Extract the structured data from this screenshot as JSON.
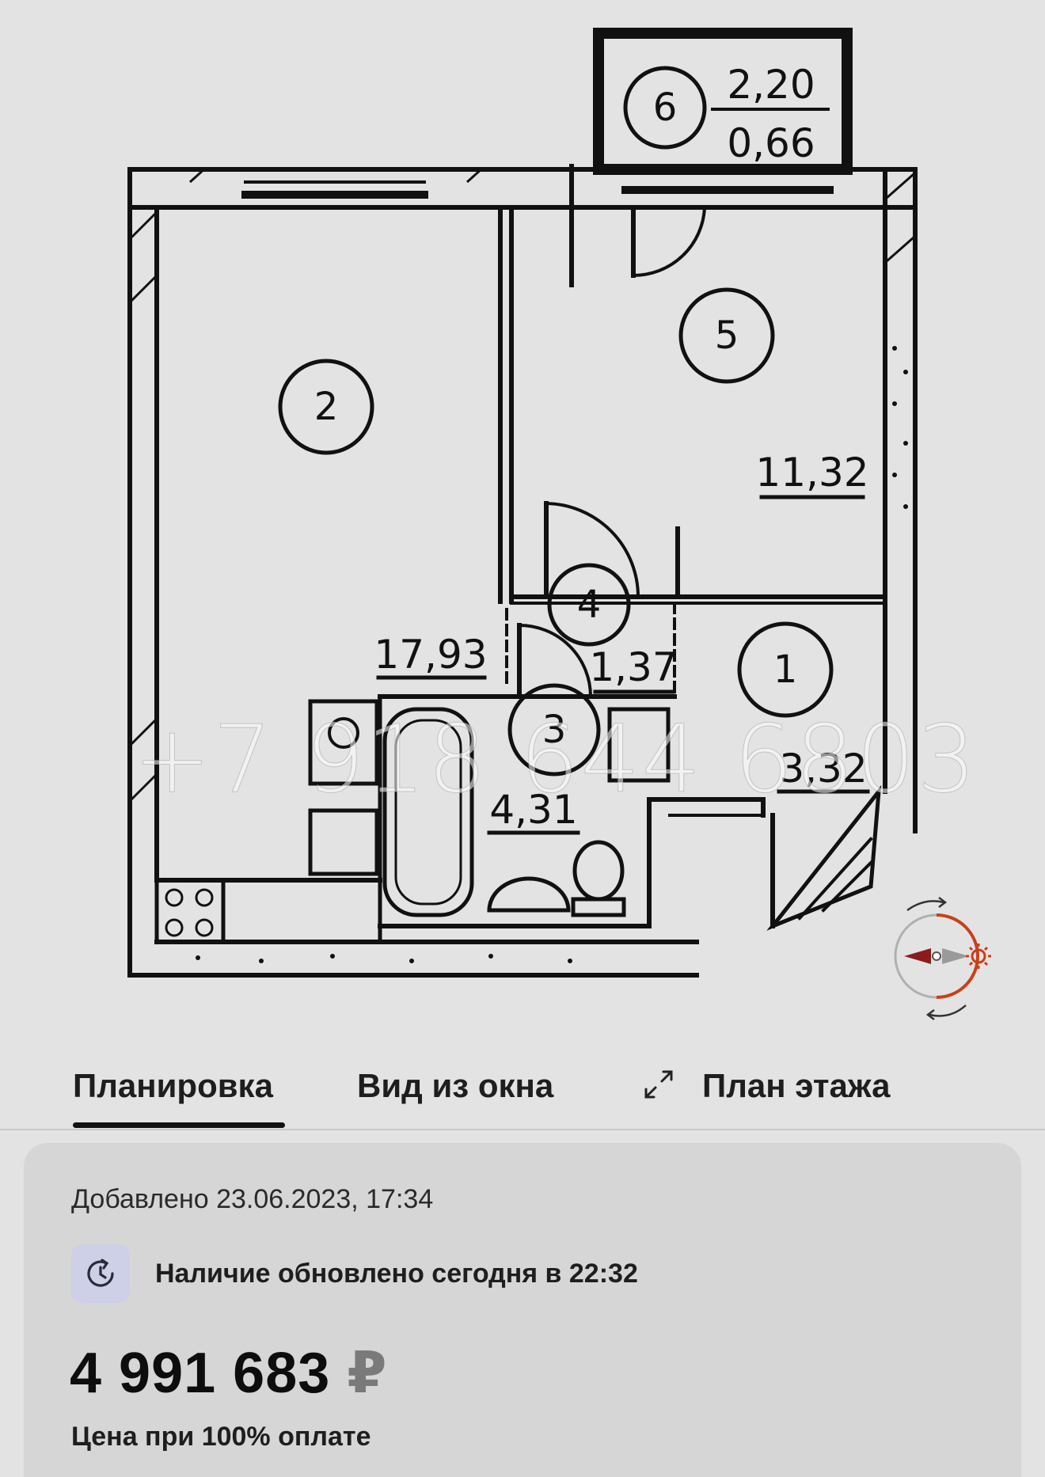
{
  "plan": {
    "rooms": [
      {
        "number": "1",
        "area": "3,32"
      },
      {
        "number": "2",
        "area": "17,93"
      },
      {
        "number": "3",
        "area": "4,31"
      },
      {
        "number": "4",
        "area": "1,37"
      },
      {
        "number": "5",
        "area": "11,32"
      },
      {
        "number": "6",
        "area": "2,20",
        "area_reduced": "0,66"
      }
    ],
    "watermark": "+7 918 644 6803",
    "compass_icon": "compass-icon"
  },
  "tabs": {
    "plan_label": "Планировка",
    "view_label": "Вид из окна",
    "floor_label": "План этажа",
    "expand_icon": "expand-arrows-icon"
  },
  "info": {
    "added": "Добавлено 23.06.2023, 17:34",
    "availability_icon": "clock-refresh-icon",
    "availability": "Наличие обновлено сегодня в 22:32",
    "price_value": "4 991 683",
    "price_currency": "₽",
    "price_note": "Цена при 100% оплате"
  },
  "colors": {
    "background": "#e3e3e3",
    "card": "#d6d6d6",
    "availability_icon_bg": "#cdd0e6",
    "compass_accent": "#c8401a"
  }
}
